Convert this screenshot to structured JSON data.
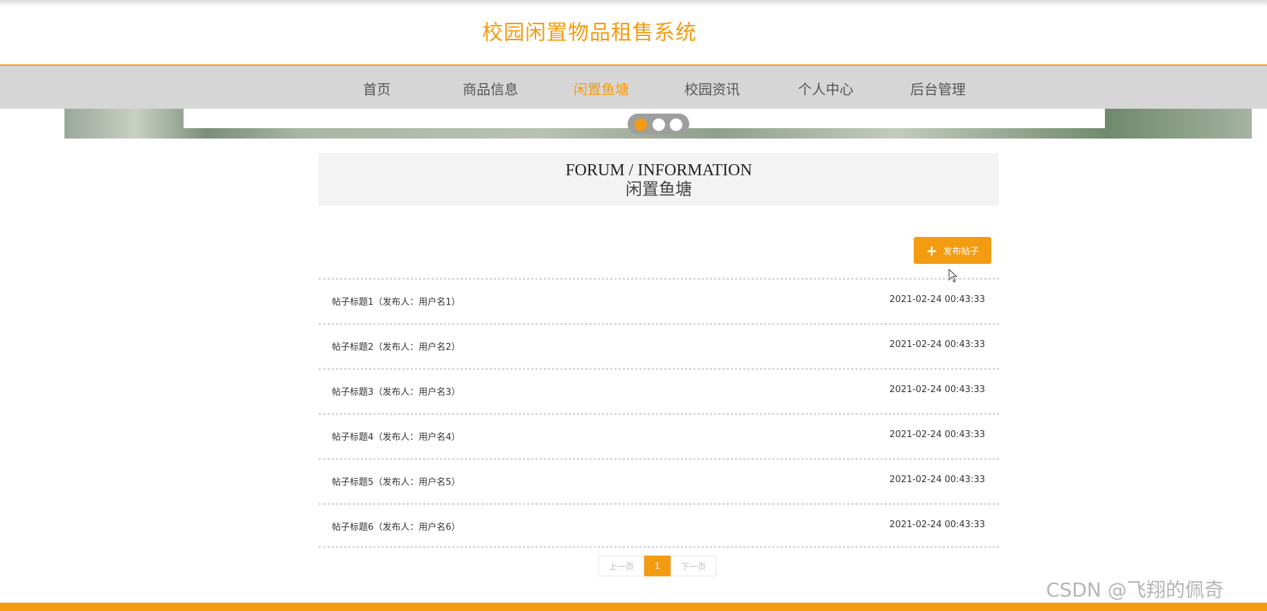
{
  "site": {
    "title": "校园闲置物品租售系统"
  },
  "nav": {
    "items": [
      {
        "label": "首页",
        "active": false
      },
      {
        "label": "商品信息",
        "active": false
      },
      {
        "label": "闲置鱼塘",
        "active": true
      },
      {
        "label": "校园资讯",
        "active": false
      },
      {
        "label": "个人中心",
        "active": false
      },
      {
        "label": "后台管理",
        "active": false
      }
    ]
  },
  "carousel": {
    "slide_count": 3,
    "active_index": 0
  },
  "forum": {
    "heading_en": "FORUM / INFORMATION",
    "heading_cn": "闲置鱼塘",
    "post_button_label": "发布帖子",
    "post_button_icon": "plus-icon",
    "posts": [
      {
        "title": "帖子标题1（发布人：用户名1）",
        "time": "2021-02-24 00:43:33"
      },
      {
        "title": "帖子标题2（发布人：用户名2）",
        "time": "2021-02-24 00:43:33"
      },
      {
        "title": "帖子标题3（发布人：用户名3）",
        "time": "2021-02-24 00:43:33"
      },
      {
        "title": "帖子标题4（发布人：用户名4）",
        "time": "2021-02-24 00:43:33"
      },
      {
        "title": "帖子标题5（发布人：用户名5）",
        "time": "2021-02-24 00:43:33"
      },
      {
        "title": "帖子标题6（发布人：用户名6）",
        "time": "2021-02-24 00:43:33"
      }
    ]
  },
  "pagination": {
    "prev_label": "上一页",
    "current_page": "1",
    "next_label": "下一页"
  },
  "watermark": "CSDN @飞翔的佩奇",
  "colors": {
    "accent": "#f39c12",
    "nav_bg": "#d6d6d6",
    "header_bg": "#f3f3f3"
  }
}
